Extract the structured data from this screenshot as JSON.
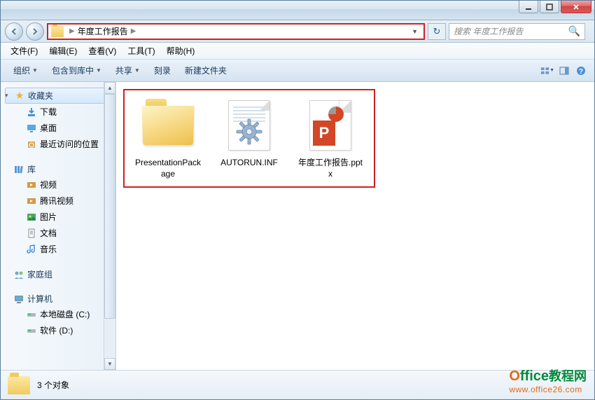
{
  "address": {
    "folder_name": "年度工作报告"
  },
  "search": {
    "placeholder": "搜索 年度工作报告"
  },
  "menu": {
    "file": "文件(F)",
    "edit": "编辑(E)",
    "view": "查看(V)",
    "tools": "工具(T)",
    "help": "帮助(H)"
  },
  "toolbar": {
    "organize": "组织",
    "include": "包含到库中",
    "share": "共享",
    "burn": "刻录",
    "newfolder": "新建文件夹"
  },
  "sidebar": {
    "favorites": "收藏夹",
    "downloads": "下载",
    "desktop": "桌面",
    "recent": "最近访问的位置",
    "libraries": "库",
    "videos": "视频",
    "tencent": "腾讯视频",
    "pictures": "图片",
    "documents": "文档",
    "music": "音乐",
    "homegroup": "家庭组",
    "computer": "计算机",
    "disk_c": "本地磁盘 (C:)",
    "disk_d": "软件 (D:)"
  },
  "files": {
    "0": {
      "name": "PresentationPackage"
    },
    "1": {
      "name": "AUTORUN.INF"
    },
    "2": {
      "name": "年度工作报告.pptx"
    }
  },
  "status": {
    "count_text": "3 个对象"
  },
  "watermark": {
    "brand_o": "O",
    "brand_rest": "ffice",
    "brand_cn": "教程网",
    "url": "www.office26.com"
  }
}
